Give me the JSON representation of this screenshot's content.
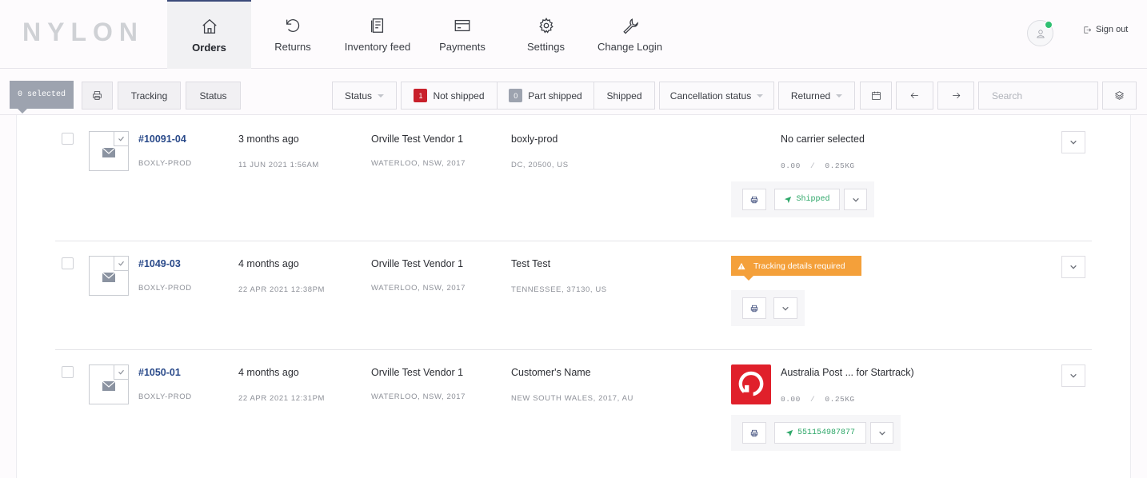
{
  "brand": {
    "logo": "NYLON"
  },
  "nav": [
    {
      "label": "Orders",
      "icon": "home-icon",
      "active": true
    },
    {
      "label": "Returns",
      "icon": "undo-icon"
    },
    {
      "label": "Inventory feed",
      "icon": "document-icon"
    },
    {
      "label": "Payments",
      "icon": "credit-card-icon"
    },
    {
      "label": "Settings",
      "icon": "gear-icon"
    },
    {
      "label": "Change Login",
      "icon": "wrench-icon"
    }
  ],
  "user": {
    "signout_label": "Sign out",
    "online_color": "#2fbf71"
  },
  "toolbar": {
    "selected_label": "0 selected",
    "tracking_label": "Tracking",
    "status_tab_label": "Status",
    "status_filter_label": "Status",
    "not_shipped_count": "1",
    "not_shipped_label": "Not shipped",
    "part_shipped_count": "0",
    "part_shipped_label": "Part shipped",
    "shipped_label": "Shipped",
    "cancellation_label": "Cancellation status",
    "returned_label": "Returned",
    "search_placeholder": "Search",
    "colors": {
      "not_shipped_badge": "#c8202b",
      "part_shipped_badge": "#9da3af"
    }
  },
  "orders": [
    {
      "id": "#10091-04",
      "store": "BOXLY-PROD",
      "relative_date": "3 months ago",
      "date": "11 JUN 2021 1:56AM",
      "vendor": "Orville Test Vendor 1",
      "vendor_location": "WATERLOO, NSW, 2017",
      "customer": "boxly-prod",
      "customer_location": "DC, 20500, US",
      "carrier": "No carrier selected",
      "weight": "0.00",
      "weight_max": "0.25KG",
      "status_button": "Shipped"
    },
    {
      "id": "#1049-03",
      "store": "BOXLY-PROD",
      "relative_date": "4 months ago",
      "date": "22 APR 2021 12:38PM",
      "vendor": "Orville Test Vendor 1",
      "vendor_location": "WATERLOO, NSW, 2017",
      "customer": "Test Test",
      "customer_location": "TENNESSEE, 37130, US",
      "warning": "Tracking details required",
      "warning_color": "#f4a03a"
    },
    {
      "id": "#1050-01",
      "store": "BOXLY-PROD",
      "relative_date": "4 months ago",
      "date": "22 APR 2021 12:31PM",
      "vendor": "Orville Test Vendor 1",
      "vendor_location": "WATERLOO, NSW, 2017",
      "customer": "Customer's Name",
      "customer_location": "NEW SOUTH WALES, 2017, AU",
      "carrier": "Australia Post ... for Startrack)",
      "carrier_logo_color": "#e0202b",
      "weight": "0.00",
      "weight_max": "0.25KG",
      "tracking_number": "551154987877"
    }
  ]
}
